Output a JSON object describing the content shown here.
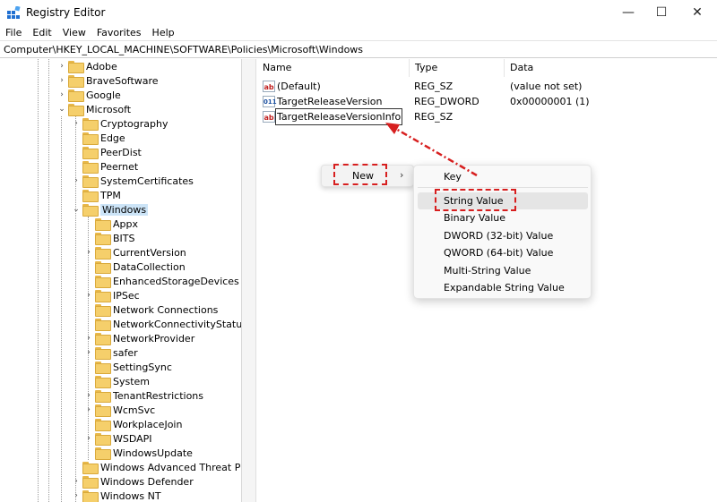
{
  "window": {
    "title": "Registry Editor",
    "minimize_glyph": "—",
    "maximize_glyph": "☐",
    "close_glyph": "✕"
  },
  "menubar": [
    "File",
    "Edit",
    "View",
    "Favorites",
    "Help"
  ],
  "address": "Computer\\HKEY_LOCAL_MACHINE\\SOFTWARE\\Policies\\Microsoft\\Windows",
  "tree": {
    "items": [
      {
        "label": "Adobe",
        "expander": "›"
      },
      {
        "label": "BraveSoftware",
        "expander": "›"
      },
      {
        "label": "Google",
        "expander": "›"
      },
      {
        "label": "Microsoft",
        "expander": "⌄"
      },
      {
        "label": "Cryptography",
        "expander": "›"
      },
      {
        "label": "Edge",
        "expander": ""
      },
      {
        "label": "PeerDist",
        "expander": ""
      },
      {
        "label": "Peernet",
        "expander": ""
      },
      {
        "label": "SystemCertificates",
        "expander": "›"
      },
      {
        "label": "TPM",
        "expander": ""
      },
      {
        "label": "Windows",
        "expander": "⌄"
      },
      {
        "label": "Appx",
        "expander": ""
      },
      {
        "label": "BITS",
        "expander": ""
      },
      {
        "label": "CurrentVersion",
        "expander": "›"
      },
      {
        "label": "DataCollection",
        "expander": ""
      },
      {
        "label": "EnhancedStorageDevices",
        "expander": ""
      },
      {
        "label": "IPSec",
        "expander": "›"
      },
      {
        "label": "Network Connections",
        "expander": ""
      },
      {
        "label": "NetworkConnectivityStatusInd",
        "expander": ""
      },
      {
        "label": "NetworkProvider",
        "expander": "›"
      },
      {
        "label": "safer",
        "expander": "›"
      },
      {
        "label": "SettingSync",
        "expander": ""
      },
      {
        "label": "System",
        "expander": ""
      },
      {
        "label": "TenantRestrictions",
        "expander": "›"
      },
      {
        "label": "WcmSvc",
        "expander": "›"
      },
      {
        "label": "WorkplaceJoin",
        "expander": ""
      },
      {
        "label": "WSDAPI",
        "expander": "›"
      },
      {
        "label": "WindowsUpdate",
        "expander": ""
      },
      {
        "label": "Windows Advanced Threat Protec",
        "expander": ""
      },
      {
        "label": "Windows Defender",
        "expander": "›"
      },
      {
        "label": "Windows NT",
        "expander": "›"
      }
    ]
  },
  "list": {
    "columns": [
      "Name",
      "Type",
      "Data"
    ],
    "rows": [
      {
        "icon": "ab",
        "name": "(Default)",
        "type": "REG_SZ",
        "data": "(value not set)"
      },
      {
        "icon": "011",
        "name": "TargetReleaseVersion",
        "type": "REG_DWORD",
        "data": "0x00000001 (1)"
      },
      {
        "icon": "ab",
        "name": "TargetReleaseVersionInfo",
        "type": "REG_SZ",
        "data": ""
      }
    ]
  },
  "context_menu": {
    "new_label": "New",
    "arrow_glyph": "›",
    "submenu": [
      "Key",
      "String Value",
      "Binary Value",
      "DWORD (32-bit) Value",
      "QWORD (64-bit) Value",
      "Multi-String Value",
      "Expandable String Value"
    ]
  },
  "colors": {
    "annotation": "#d71f1f",
    "selection": "#cce4f7",
    "folder": "#f5cf6b"
  }
}
